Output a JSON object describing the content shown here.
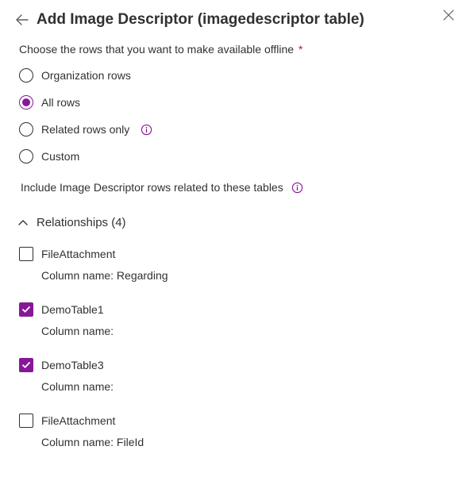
{
  "header": {
    "title": "Add Image Descriptor (imagedescriptor table)"
  },
  "section": {
    "prompt": "Choose the rows that you want to make available offline",
    "required_mark": "*"
  },
  "radios": [
    {
      "label": "Organization rows",
      "selected": false,
      "info": false
    },
    {
      "label": "All rows",
      "selected": true,
      "info": false
    },
    {
      "label": "Related rows only",
      "selected": false,
      "info": true
    },
    {
      "label": "Custom",
      "selected": false,
      "info": false
    }
  ],
  "related_label": "Include Image Descriptor rows related to these tables",
  "relationships": {
    "title": "Relationships",
    "count": 4,
    "items": [
      {
        "name": "FileAttachment",
        "column_label": "Column name:",
        "column_value": "Regarding",
        "checked": false
      },
      {
        "name": "DemoTable1",
        "column_label": "Column name:",
        "column_value": "",
        "checked": true
      },
      {
        "name": "DemoTable3",
        "column_label": "Column name:",
        "column_value": "",
        "checked": true
      },
      {
        "name": "FileAttachment",
        "column_label": "Column name:",
        "column_value": "FileId",
        "checked": false
      }
    ]
  }
}
